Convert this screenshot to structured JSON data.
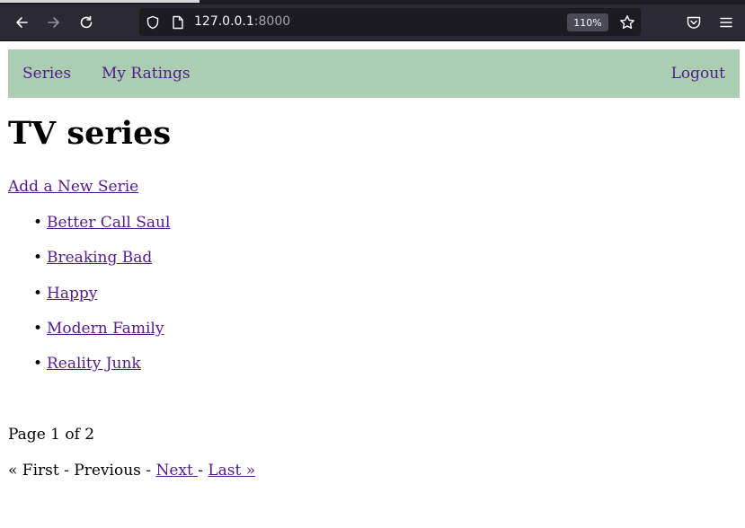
{
  "browser": {
    "url_host": "127.0.0.1",
    "url_port": ":8000",
    "zoom": "110%",
    "icons": {
      "back": "back-arrow-icon",
      "forward": "forward-arrow-icon",
      "reload": "reload-icon",
      "shield": "shield-icon",
      "page": "page-icon",
      "bookmark": "star-icon",
      "pocket": "pocket-icon",
      "menu": "hamburger-menu-icon"
    }
  },
  "nav": {
    "series": "Series",
    "ratings": "My Ratings",
    "logout": "Logout",
    "bg_color": "#abcdb1"
  },
  "main": {
    "title": "TV series",
    "add_link": "Add a New Serie",
    "series": [
      "Better Call Saul",
      "Breaking Bad",
      "Happy",
      "Modern Family",
      "Reality Junk"
    ],
    "bullet": "•"
  },
  "pagination": {
    "info": "Page 1 of 2",
    "first": "« First",
    "sep1": " - ",
    "previous": "Previous",
    "sep2": " - ",
    "next": "Next ",
    "sep3": "- ",
    "last": "Last »"
  }
}
